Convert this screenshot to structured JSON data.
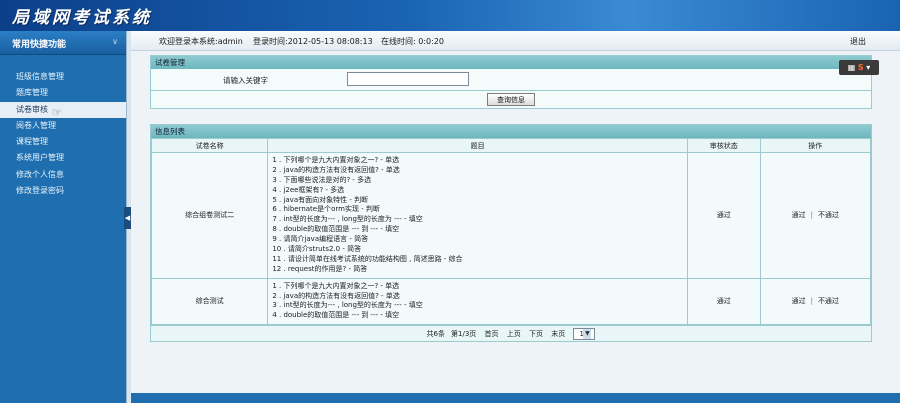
{
  "app": {
    "title": "局域网考试系统"
  },
  "sidebar": {
    "header": "常用快捷功能",
    "items": [
      {
        "label": "班级信息管理"
      },
      {
        "label": "题库管理"
      },
      {
        "label": "试卷审核"
      },
      {
        "label": "阅卷人管理"
      },
      {
        "label": "课程管理"
      },
      {
        "label": "系统用户管理"
      },
      {
        "label": "修改个人信息"
      },
      {
        "label": "修改登录密码"
      }
    ],
    "active_index": 2
  },
  "topbar": {
    "welcome": "欢迎登录本系统:admin",
    "login_time": "登录时间:2012-05-13 08:08:13",
    "online_time": "在线时间: 0:0:20",
    "exit": "退出"
  },
  "search_panel": {
    "title": "试卷管理",
    "keyword_label": "请输入关键字",
    "keyword_value": "",
    "query_button": "查询信息"
  },
  "list_panel": {
    "title": "信息列表",
    "columns": [
      "试卷名称",
      "题目",
      "审核状态",
      "操作"
    ],
    "rows": [
      {
        "name": "综合组卷测试二",
        "questions": [
          "1 . 下列哪个是九大内置对象之一? - 单选",
          "2 . java的构造方法有没有返回值? - 单选",
          "3 . 下面哪些说法是对的? - 多选",
          "4 . j2ee框架有? - 多选",
          "5 . java有面向对象特性 - 判断",
          "6 . hibernate是个orm实现 - 判断",
          "7 . int型的长度为--- , long型的长度为 --- - 填空",
          "8 . double的取值范围是 --- 到 --- - 填空",
          "9 . 请简介java编程语言 - 简答",
          "10 . 请简介struts2.0 - 简答",
          "11 . 请设计简单在线考试系统的功能结构图 , 简述思路 - 综合",
          "12 . request的作用是? - 简答"
        ],
        "status": "通过",
        "op_pass": "通过",
        "op_fail": "不通过"
      },
      {
        "name": "综合测试",
        "questions": [
          "1 . 下列哪个是九大内置对象之一? - 单选",
          "2 . java的构造方法有没有返回值? - 单选",
          "3 . int型的长度为--- , long型的长度为 --- - 填空",
          "4 . double的取值范围是 --- 到 --- - 填空"
        ],
        "status": "通过",
        "op_pass": "通过",
        "op_fail": "不通过"
      }
    ],
    "op_separator": "|",
    "pager": {
      "total": "共6条",
      "page_info": "第1/3页",
      "first": "首页",
      "prev": "上页",
      "next": "下页",
      "last": "末页",
      "current_page": "1"
    }
  },
  "widget": {
    "label": "S"
  }
}
